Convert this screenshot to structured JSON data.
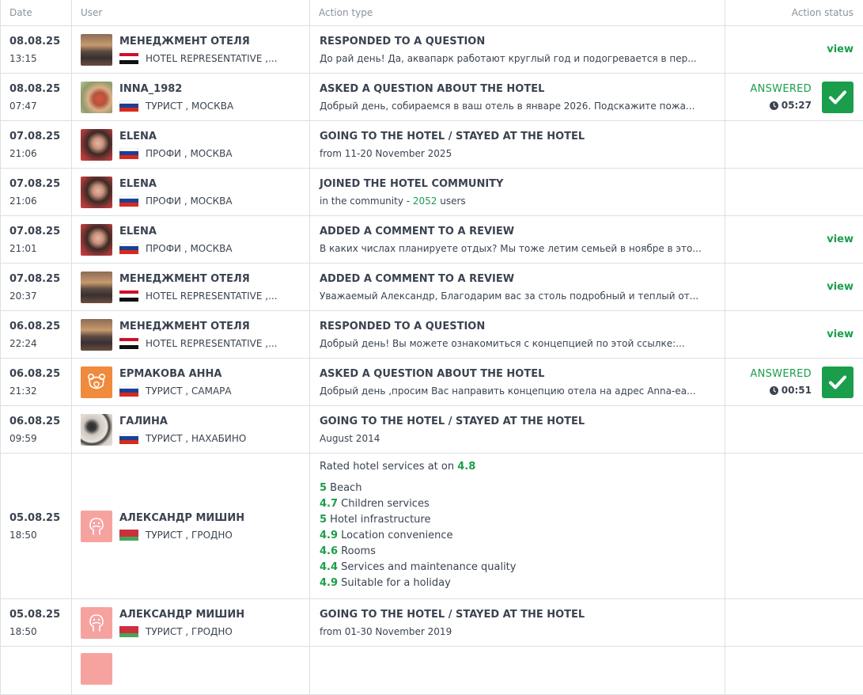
{
  "header": {
    "date": "Date",
    "user": "User",
    "action": "Action type",
    "status": "Action status"
  },
  "rows": [
    {
      "date": "08.08.25",
      "time": "13:15",
      "name": "МЕНЕДЖМЕНТ ОТЕЛЯ",
      "meta": "HOTEL REPRESENTATIVE ,...",
      "title": "RESPONDED TO A QUESTION",
      "desc": "До рай день! Да, аквапарк работают круглый год и подогревается в пер...",
      "view": "view"
    },
    {
      "date": "08.08.25",
      "time": "07:47",
      "name": "INNA_1982",
      "meta": "ТУРИСТ , МОСКВА",
      "title": "ASKED A QUESTION ABOUT THE HOTEL",
      "desc": "Добрый день, собираемся в ваш отель в январе 2026. Подскажите пожа...",
      "answered": "ANSWERED",
      "answer_time": "05:27"
    },
    {
      "date": "07.08.25",
      "time": "21:06",
      "name": "ELENA",
      "meta": "ПРОФИ , МОСКВА",
      "title": "GOING TO THE HOTEL / STAYED AT THE HOTEL",
      "desc": "from 11-20 November 2025"
    },
    {
      "date": "07.08.25",
      "time": "21:06",
      "name": "ELENA",
      "meta": "ПРОФИ , МОСКВА",
      "title": "JOINED THE HOTEL COMMUNITY",
      "desc_pre": "in the community - ",
      "desc_num": "2052",
      "desc_post": " users"
    },
    {
      "date": "07.08.25",
      "time": "21:01",
      "name": "ELENA",
      "meta": "ПРОФИ , МОСКВА",
      "title": "ADDED A COMMENT TO A REVIEW",
      "desc": "В каких числах планируете отдых? Мы тоже летим семьей в ноябре в это...",
      "view": "view"
    },
    {
      "date": "07.08.25",
      "time": "20:37",
      "name": "МЕНЕДЖМЕНТ ОТЕЛЯ",
      "meta": "HOTEL REPRESENTATIVE ,...",
      "title": "ADDED A COMMENT TO A REVIEW",
      "desc": "Уважаемый Александр, Благодарим вас за столь подробный и теплый от...",
      "view": "view"
    },
    {
      "date": "06.08.25",
      "time": "22:24",
      "name": "МЕНЕДЖМЕНТ ОТЕЛЯ",
      "meta": "HOTEL REPRESENTATIVE ,...",
      "title": "RESPONDED TO A QUESTION",
      "desc": "Добрый день! Вы можете ознакомиться с концепцией по этой ссылке:...",
      "view": "view"
    },
    {
      "date": "06.08.25",
      "time": "21:32",
      "name": "ЕРМАКОВА АННА",
      "meta": "ТУРИСТ , САМАРА",
      "title": "ASKED A QUESTION ABOUT THE HOTEL",
      "desc": "Добрый день ,просим Вас направить концепцию отела на адрес Anna-ea...",
      "answered": "ANSWERED",
      "answer_time": "00:51"
    },
    {
      "date": "06.08.25",
      "time": "09:59",
      "name": "ГАЛИНА",
      "meta": "ТУРИСТ , НАХАБИНО",
      "title": "GOING TO THE HOTEL / STAYED AT THE HOTEL",
      "desc": "August 2014"
    },
    {
      "date": "05.08.25",
      "time": "18:50",
      "name": "АЛЕКСАНДР МИШИН",
      "meta": "ТУРИСТ , ГРОДНО",
      "rating_head": "Rated hotel services at on ",
      "rating_total": "4.8",
      "ratings": [
        {
          "v": "5",
          "label": " Beach"
        },
        {
          "v": "4.7",
          "label": " Children services"
        },
        {
          "v": "5",
          "label": " Hotel infrastructure"
        },
        {
          "v": "4.9",
          "label": " Location convenience"
        },
        {
          "v": "4.6",
          "label": " Rooms"
        },
        {
          "v": "4.4",
          "label": " Services and maintenance quality"
        },
        {
          "v": "4.9",
          "label": " Suitable for a holiday"
        }
      ]
    },
    {
      "date": "05.08.25",
      "time": "18:50",
      "name": "АЛЕКСАНДР МИШИН",
      "meta": "ТУРИСТ , ГРОДНО",
      "title": "GOING TO THE HOTEL / STAYED AT THE HOTEL",
      "desc": "from 01-30 November 2019"
    }
  ],
  "colors": {
    "accent": "#1a9e4b",
    "border": "#dcdfe3",
    "text": "#3a4350",
    "muted": "#8a939c"
  }
}
